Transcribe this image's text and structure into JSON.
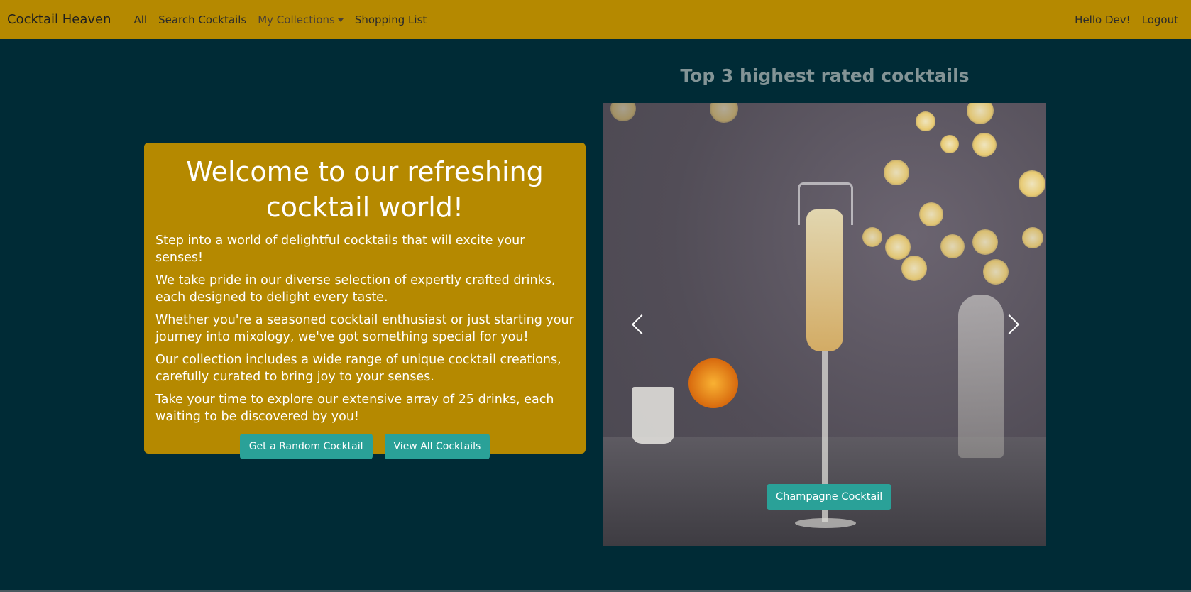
{
  "navbar": {
    "brand": "Cocktail Heaven",
    "links": {
      "all": "All",
      "search": "Search Cocktails",
      "collections": "My Collections",
      "shopping_list": "Shopping List"
    },
    "greeting": "Hello Dev!",
    "logout": "Logout"
  },
  "welcome": {
    "title": "Welcome to our refreshing cocktail world!",
    "paragraphs": [
      "Step into a world of delightful cocktails that will excite your senses!",
      "We take pride in our diverse selection of expertly crafted drinks, each designed to delight every taste.",
      "Whether you're a seasoned cocktail enthusiast or just starting your journey into mixology, we've got something special for you!",
      "Our collection includes a wide range of unique cocktail creations, carefully curated to bring joy to your senses.",
      "Take your time to explore our extensive array of 25 drinks, each waiting to be discovered by you!"
    ],
    "random_button": "Get a Random Cocktail",
    "view_all_button": "View All Cocktails"
  },
  "carousel": {
    "heading": "Top 3 highest rated cocktails",
    "current_caption": "Champagne Cocktail",
    "prev_icon": "chevron-left-icon",
    "next_icon": "chevron-right-icon"
  },
  "colors": {
    "navbar_bg": "#b58900",
    "page_bg": "#002b36",
    "button_bg": "#2aa198",
    "heading_text": "#839496"
  }
}
